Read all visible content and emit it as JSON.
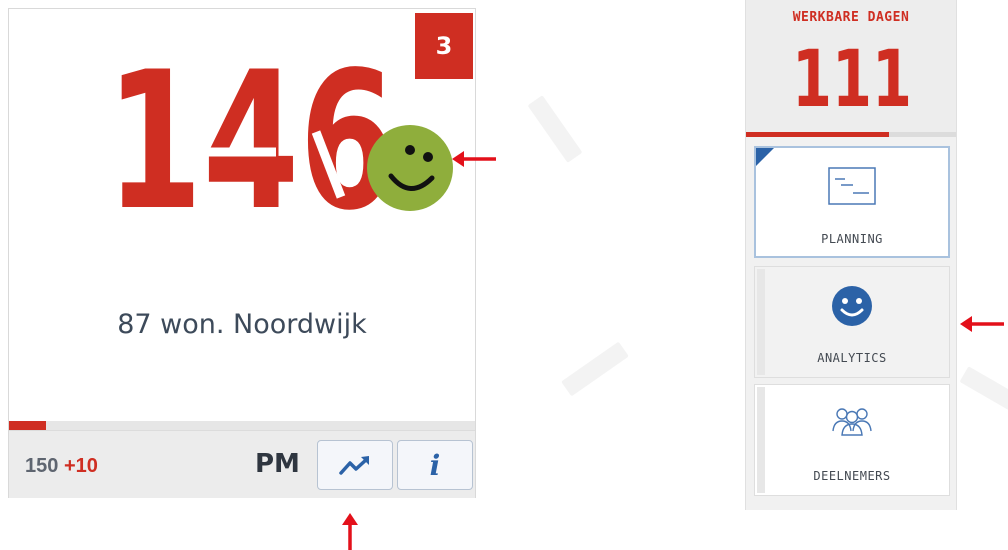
{
  "card": {
    "badge": "3",
    "big_number": "146",
    "project_name": "87 won. Noordwijk",
    "progress_fraction": 0.08,
    "count_base": "150",
    "count_plus": "+10",
    "role": "PM"
  },
  "side_panel": {
    "workable_days_label": "WERKBARE DAGEN",
    "workable_days_value": "111",
    "workable_days_progress_fraction": 0.68,
    "nav": [
      {
        "label": "PLANNING",
        "icon": "gantt-chart-icon"
      },
      {
        "label": "ANALYTICS",
        "icon": "smiley-icon"
      },
      {
        "label": "DEELNEMERS",
        "icon": "people-group-icon"
      }
    ]
  },
  "colors": {
    "accent_red": "#cf2e22",
    "smiley_green": "#8fae3c",
    "link_blue": "#2b62a7",
    "annotation_red": "#e3101a"
  }
}
